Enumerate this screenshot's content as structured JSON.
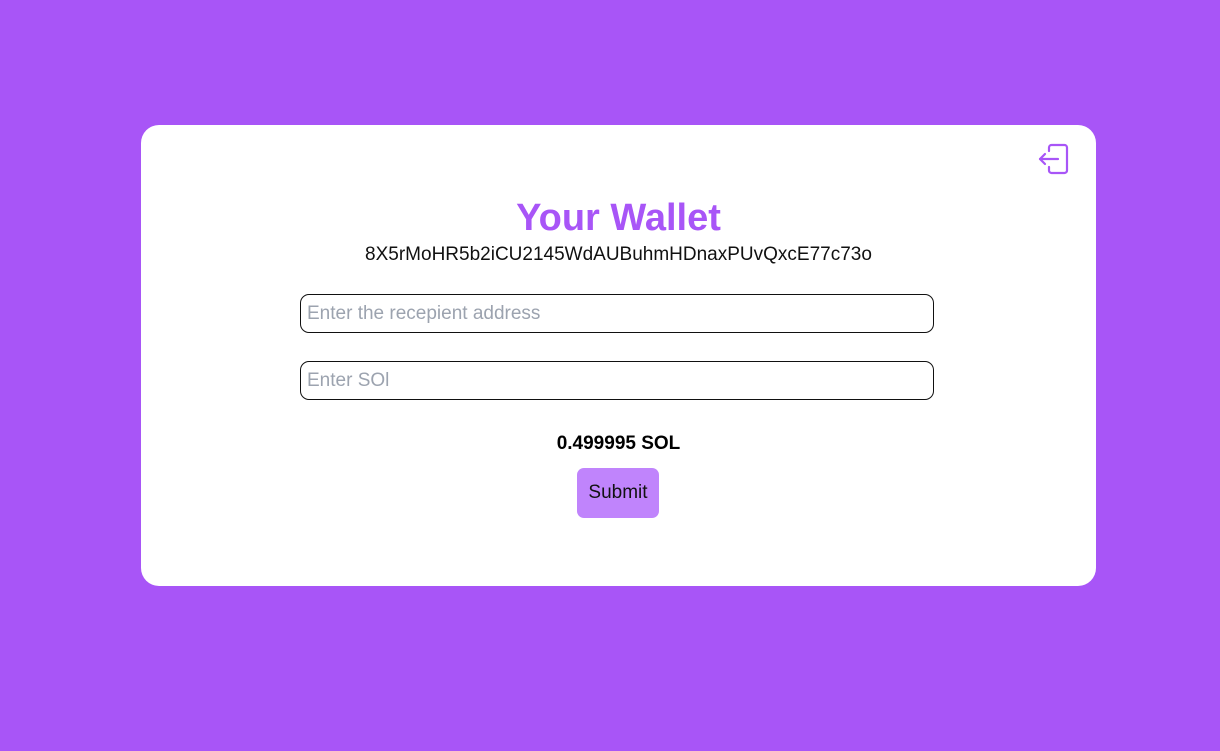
{
  "wallet": {
    "title": "Your Wallet",
    "address": "8X5rMoHR5b2iCU2145WdAUBuhmHDnaxPUvQxcE77c73o",
    "balance": "0.499995 SOL"
  },
  "form": {
    "recipient_placeholder": "Enter the recepient address",
    "recipient_value": "",
    "amount_placeholder": "Enter SOl",
    "amount_value": "",
    "submit_label": "Submit"
  },
  "icons": {
    "logout": "logout-icon"
  },
  "colors": {
    "background": "#a855f7",
    "accent": "#a855f7",
    "button": "#c084fc",
    "card": "#ffffff"
  }
}
